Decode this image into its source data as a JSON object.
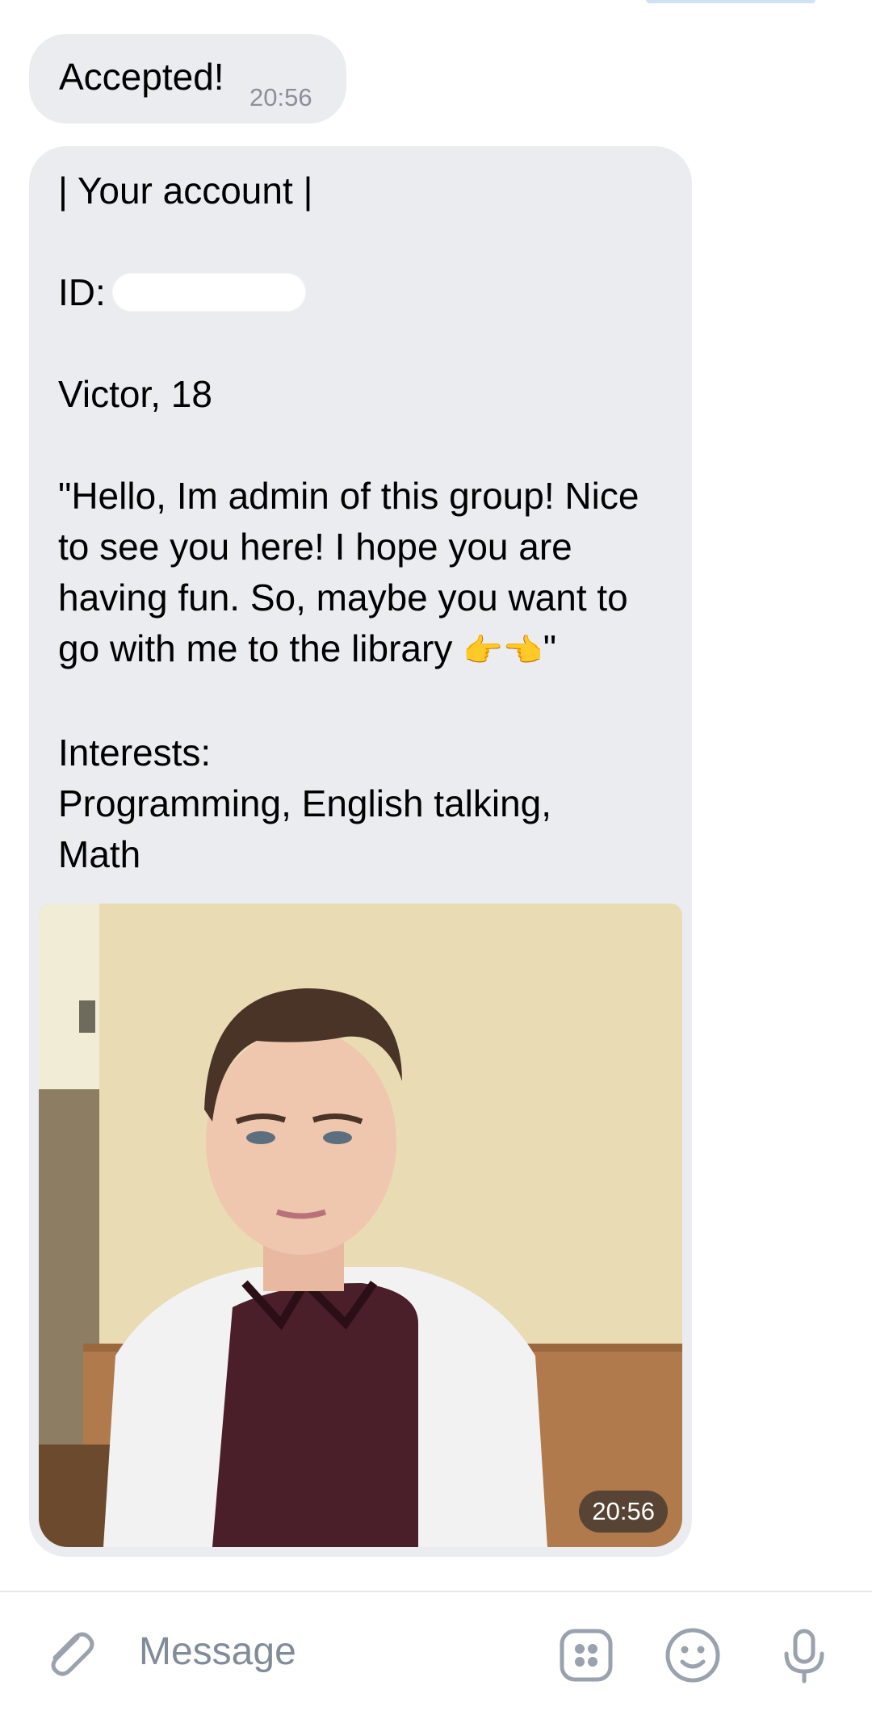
{
  "messages": [
    {
      "text": "Accepted!",
      "time": "20:56"
    },
    {
      "card": {
        "header": "| Your account |",
        "id_label": "ID:",
        "name_age": "Victor, 18",
        "quote_l1": "\"Hello, Im admin of this group! Nice",
        "quote_l2": "to see you here! I hope you are",
        "quote_l3": "having fun. So, maybe you want to",
        "quote_l4": "go with me to the library",
        "quote_emoji": "👉👈",
        "quote_end": "\"",
        "interests_label": "Interests:",
        "interests_l1": "Programming, English talking,",
        "interests_l2": "Math"
      },
      "photo_time": "20:56"
    }
  ],
  "composer": {
    "placeholder": "Message",
    "icons": [
      "paperclip-icon",
      "keyboard-icon",
      "emoji-icon",
      "microphone-icon"
    ]
  },
  "colors": {
    "bubble": "#ebecf0",
    "placeholder": "#818c99",
    "icon": "#99a2ad"
  }
}
